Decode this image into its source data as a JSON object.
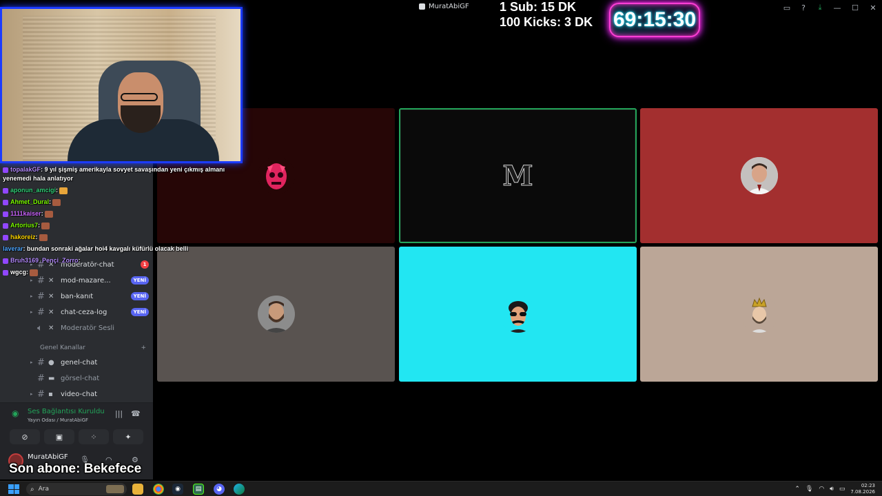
{
  "window": {
    "title": "MuratAbiGF"
  },
  "overlay": {
    "sub_line": "1 Sub: 15 DK",
    "kick_line": "100 Kicks: 3 DK",
    "timer": "69:15:30",
    "last_sub": "Son abone: Bekefece"
  },
  "chat": [
    {
      "user": "topalakGF",
      "color": "#b58cff",
      "text": ": 9 yıl şişmiş amerikayla sovyet savaşından yeni çıkmış almanı"
    },
    {
      "user": "",
      "color": "#ffffff",
      "text": "yenemedi hala anlatıyor"
    },
    {
      "user": "aponun_amcigi",
      "color": "#33d17a",
      "text": ":"
    },
    {
      "user": "Ahmet_Dural",
      "color": "#7cfc00",
      "text": ":"
    },
    {
      "user": "1111kaiser",
      "color": "#cc66ff",
      "text": ":"
    },
    {
      "user": "Artorius7",
      "color": "#7cfc00",
      "text": ":"
    },
    {
      "user": "hakoreiz",
      "color": "#ffd700",
      "text": ":"
    },
    {
      "user": "laverar",
      "color": "#4da6ff",
      "text": ": bundan sonraki ağalar hoi4 kavgalı küfürlü olacak belli"
    },
    {
      "user": "Bruh3169_Pençi_Zorro",
      "color": "#b58cff",
      "text": ":"
    },
    {
      "user": "wgcg",
      "color": "#ffffff",
      "text": ":"
    }
  ],
  "sidebar": {
    "channels": [
      {
        "name": "moderatör-chat",
        "badge": "1",
        "badge_type": "num",
        "icon": "cross-swords-icon"
      },
      {
        "name": "mod-mazare...",
        "badge": "YENİ",
        "badge_type": "new",
        "icon": "cross-swords-icon"
      },
      {
        "name": "ban-kanıt",
        "badge": "YENİ",
        "badge_type": "new",
        "icon": "cross-swords-icon"
      },
      {
        "name": "chat-ceza-log",
        "badge": "YENİ",
        "badge_type": "new",
        "icon": "cross-swords-icon"
      },
      {
        "name": "Moderatör Sesli",
        "badge": "",
        "badge_type": "",
        "icon": "speaker-icon"
      }
    ],
    "category": "Genel Kanallar",
    "general_channels": [
      {
        "name": "genel-chat",
        "icon": "speech-bubble-icon"
      },
      {
        "name": "görsel-chat",
        "icon": "image-icon"
      },
      {
        "name": "video-chat",
        "icon": "video-icon"
      }
    ],
    "voice": {
      "status": "Ses Bağlantısı Kuruldu",
      "channel": "Yayın Odası",
      "server": "/ MuratAbiGF"
    },
    "user": {
      "name": "MuratAbiGF"
    }
  },
  "tiles": [
    {
      "bg": "#260606",
      "kind": "demon-mask",
      "active": false
    },
    {
      "bg": "#0a0a0a",
      "kind": "m-logo",
      "label": "M",
      "active": true
    },
    {
      "bg": "#a32f2f",
      "kind": "photo-red",
      "active": false
    },
    {
      "bg": "#595350",
      "kind": "photo-bearded",
      "active": false
    },
    {
      "bg": "#22e6f2",
      "kind": "cartoon-sunglasses",
      "active": false
    },
    {
      "bg": "#bba697",
      "kind": "king-crown",
      "active": false
    }
  ],
  "taskbar": {
    "search_placeholder": "Ara",
    "time": "02:23",
    "date": "7.08.2026"
  }
}
